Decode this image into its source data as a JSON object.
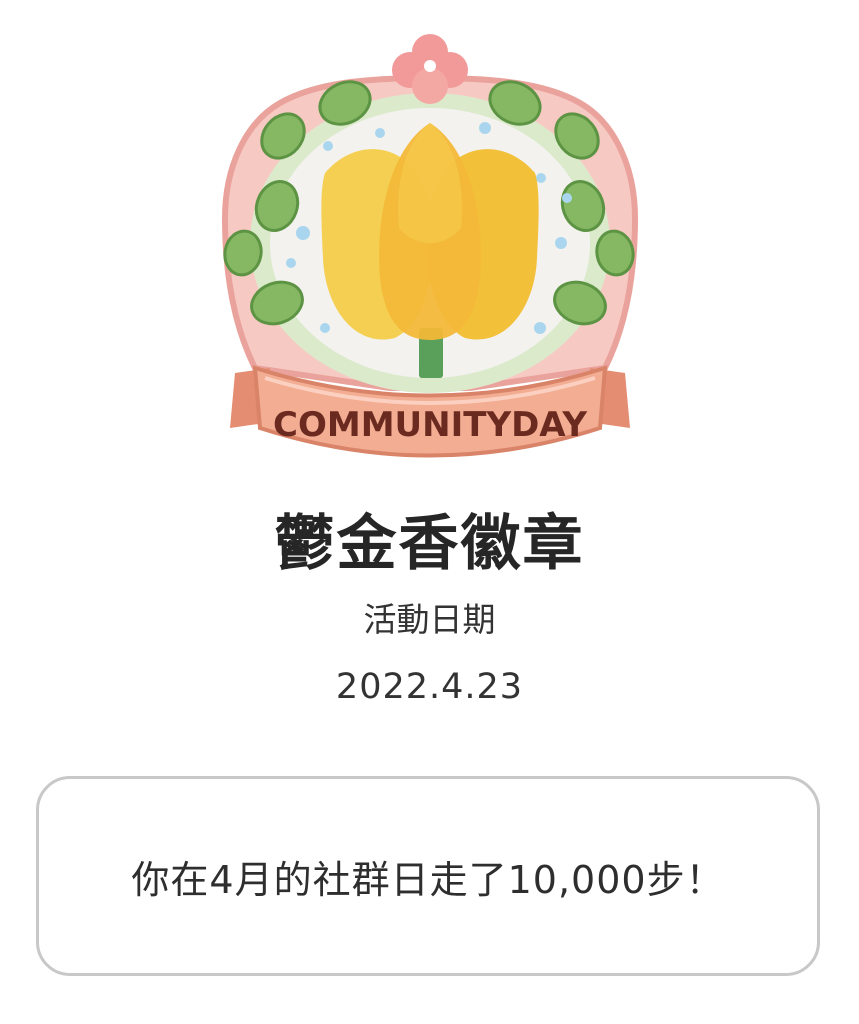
{
  "badge": {
    "ribbon_text": "COMMUNITYDAY",
    "name": "鬱金香徽章",
    "icon": "tulip-badge-icon"
  },
  "event": {
    "date_label": "活動日期",
    "date": "2022.4.23"
  },
  "message": {
    "text": "你在4月的社群日走了10,000步！"
  },
  "colors": {
    "frame_pink": "#f4b6b0",
    "ribbon": "#f0a58a",
    "ribbon_text": "#6b2a1f",
    "leaf": "#86b864",
    "tulip": "#f5c842",
    "tulip_dark": "#efad2c",
    "stem": "#5aa05a",
    "dot": "#a9d6ee",
    "card_border": "#c8c8c8"
  }
}
